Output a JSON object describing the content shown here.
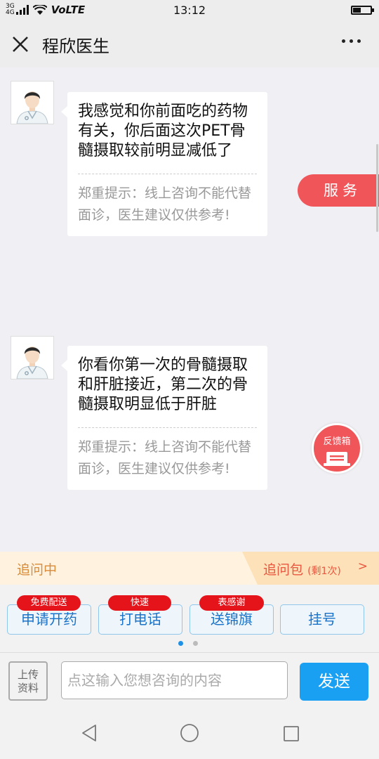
{
  "status_bar": {
    "network_top": "3G",
    "network_bottom": "4G",
    "volte": "VoLTE",
    "time": "13:12"
  },
  "header": {
    "title": "程欣医生"
  },
  "messages": [
    {
      "text": "我感觉和你前面吃的药物有关，你后面这次PET骨髓摄取较前明显减低了",
      "tip": "郑重提示：线上咨询不能代替面诊，医生建议仅供参考!"
    },
    {
      "text": "你看你第一次的骨髓摄取和肝脏接近，第二次的骨髓摄取明显低于肝脏",
      "tip": "郑重提示：线上咨询不能代替面诊，医生建议仅供参考!"
    }
  ],
  "floating": {
    "service_label": "服务",
    "feedback_label": "反馈箱"
  },
  "follow_bar": {
    "left_label": "追问中",
    "package_label": "追问包",
    "package_remaining": "(剩1次)",
    "arrow": ">"
  },
  "actions": [
    {
      "label": "申请开药",
      "badge": "免费配送"
    },
    {
      "label": "打电话",
      "badge": "快速"
    },
    {
      "label": "送锦旗",
      "badge": "表感谢"
    },
    {
      "label": "挂号",
      "badge": ""
    }
  ],
  "input_bar": {
    "upload_line1": "上传",
    "upload_line2": "资料",
    "placeholder": "点这输入您想咨询的内容",
    "send_label": "发送"
  },
  "colors": {
    "accent_red": "#f0555a",
    "send_blue": "#19a0f3",
    "badge_red": "#e5141b",
    "follow_orange": "#d98b3a"
  }
}
